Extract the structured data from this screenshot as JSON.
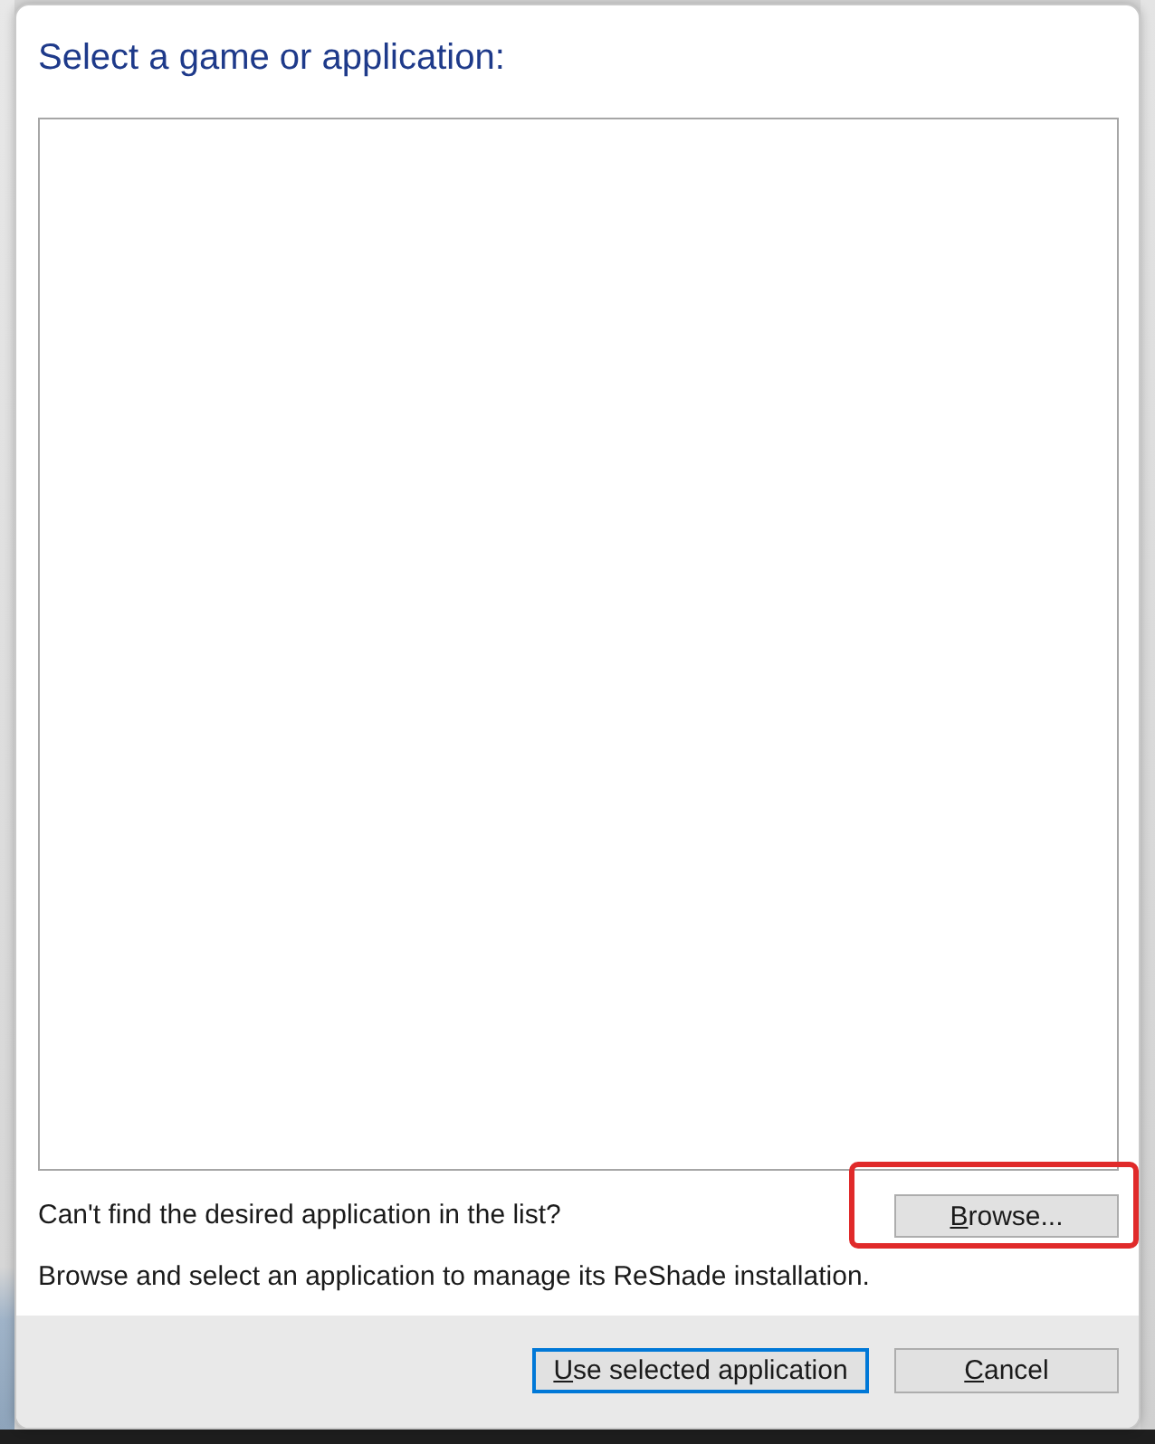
{
  "dialog": {
    "heading": "Select a game or application:"
  },
  "browse_row": {
    "prompt": "Can't find the desired application in the list?",
    "browse_button": {
      "label": "Browse...",
      "highlighted": true
    }
  },
  "hint": "Browse and select an application to manage its ReShade installation.",
  "footer": {
    "buttons": [
      {
        "label": "Use selected application",
        "default": true
      },
      {
        "label": "Cancel",
        "default": false
      }
    ]
  }
}
